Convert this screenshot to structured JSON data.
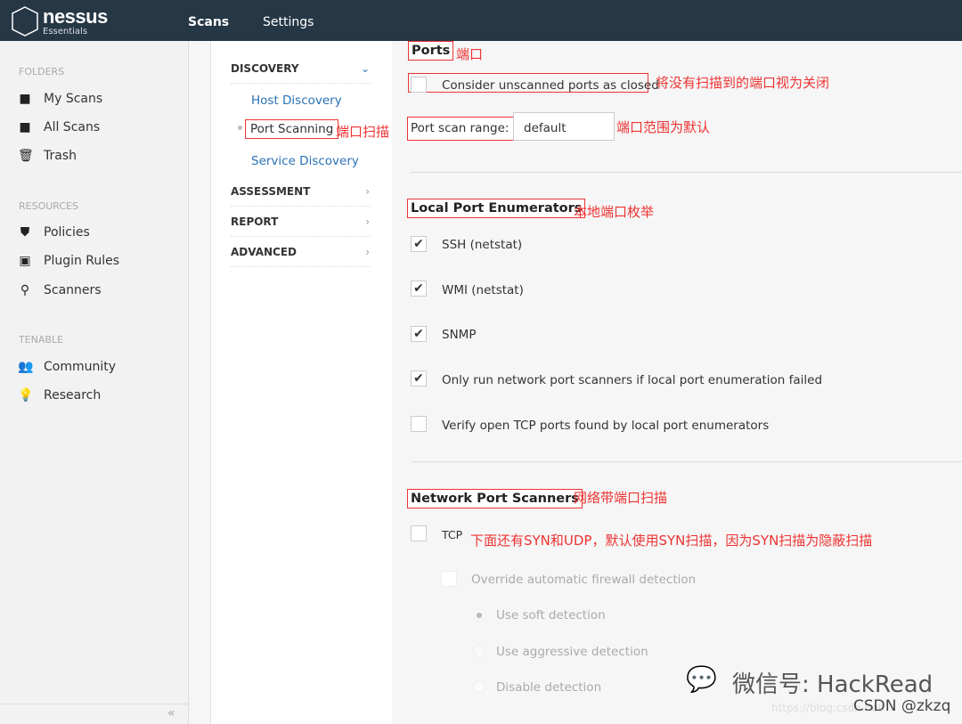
{
  "header": {
    "brand": "nessus",
    "brand_sub": "Essentials",
    "nav": [
      "Scans",
      "Settings"
    ]
  },
  "sidebar": {
    "folders_label": "FOLDERS",
    "folders": [
      "My Scans",
      "All Scans",
      "Trash"
    ],
    "resources_label": "RESOURCES",
    "resources": [
      "Policies",
      "Plugin Rules",
      "Scanners"
    ],
    "tenable_label": "TENABLE",
    "tenable": [
      "Community",
      "Research"
    ],
    "collapse": "«"
  },
  "settings_nav": {
    "sections": [
      "DISCOVERY",
      "ASSESSMENT",
      "REPORT",
      "ADVANCED"
    ],
    "discovery_items": [
      "Host Discovery",
      "Port Scanning",
      "Service Discovery"
    ],
    "annotation_port_scanning": "端口扫描"
  },
  "ports": {
    "title": "Ports",
    "annotation": "端口",
    "consider_unscanned": {
      "label": "Consider unscanned ports as closed",
      "checked": false,
      "annotation": "将没有扫描到的端口视为关闭"
    },
    "range_label": "Port scan range:",
    "range_value": "default",
    "range_annotation": "端口范围为默认"
  },
  "local": {
    "title": "Local Port Enumerators",
    "annotation": "本地端口枚举",
    "items": [
      {
        "label": "SSH (netstat)",
        "checked": true
      },
      {
        "label": "WMI (netstat)",
        "checked": true
      },
      {
        "label": "SNMP",
        "checked": true
      },
      {
        "label": "Only run network port scanners if local port enumeration failed",
        "checked": true
      },
      {
        "label": "Verify open TCP ports found by local port enumerators",
        "checked": false
      }
    ]
  },
  "network": {
    "title": "Network Port Scanners",
    "annotation": "网络带端口扫描",
    "tcp_label": "TCP",
    "tcp_checked": false,
    "tcp_annotation": "下面还有SYN和UDP，默认使用SYN扫描，因为SYN扫描为隐蔽扫描",
    "override_label": "Override automatic firewall detection",
    "radios": [
      "Use soft detection",
      "Use aggressive detection",
      "Disable detection"
    ]
  },
  "watermark": {
    "wechat": "微信号: HackRead",
    "csdn": "CSDN @zkzq",
    "url": "https://blog.csdn.net"
  }
}
